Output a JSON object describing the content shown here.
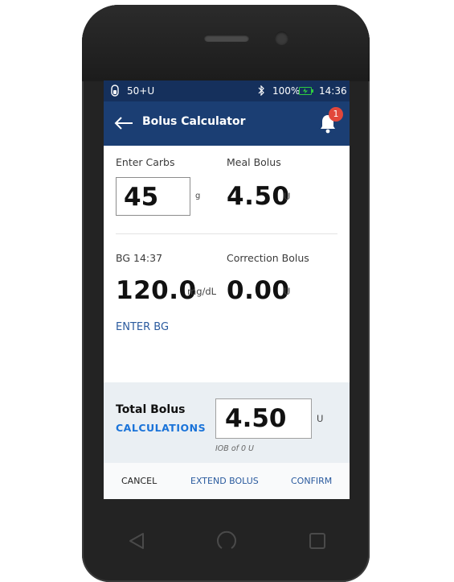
{
  "status_bar": {
    "pod_label": "50+U",
    "battery_percent": "100%",
    "time": "14:36"
  },
  "app_bar": {
    "title": "Bolus Calculator",
    "notification_count": "1"
  },
  "carbs": {
    "label": "Enter Carbs",
    "value": "45",
    "unit": "g"
  },
  "meal_bolus": {
    "label": "Meal Bolus",
    "value": "4.50",
    "unit": "U"
  },
  "bg": {
    "label": "BG 14:37",
    "value": "120.0",
    "unit": "mg/dL",
    "enter_link": "ENTER BG"
  },
  "correction_bolus": {
    "label": "Correction Bolus",
    "value": "0.00",
    "unit": "U"
  },
  "total": {
    "label": "Total Bolus",
    "calculations_link": "CALCULATIONS",
    "value": "4.50",
    "unit": "U",
    "iob_text": "IOB of 0 U"
  },
  "actions": {
    "cancel": "CANCEL",
    "extend": "EXTEND BOLUS",
    "confirm": "CONFIRM"
  },
  "colors": {
    "status_bar": "#15305c",
    "app_bar": "#1b3e73",
    "link": "#2a5a9e",
    "calculations_link": "#1a73d9",
    "badge": "#e2473b",
    "battery_charging": "#2ecc40"
  },
  "icons": [
    "pod-icon",
    "bluetooth-icon",
    "battery-charging-icon",
    "back-arrow-icon",
    "bell-icon",
    "nav-back-icon",
    "nav-home-icon",
    "nav-recents-icon"
  ]
}
